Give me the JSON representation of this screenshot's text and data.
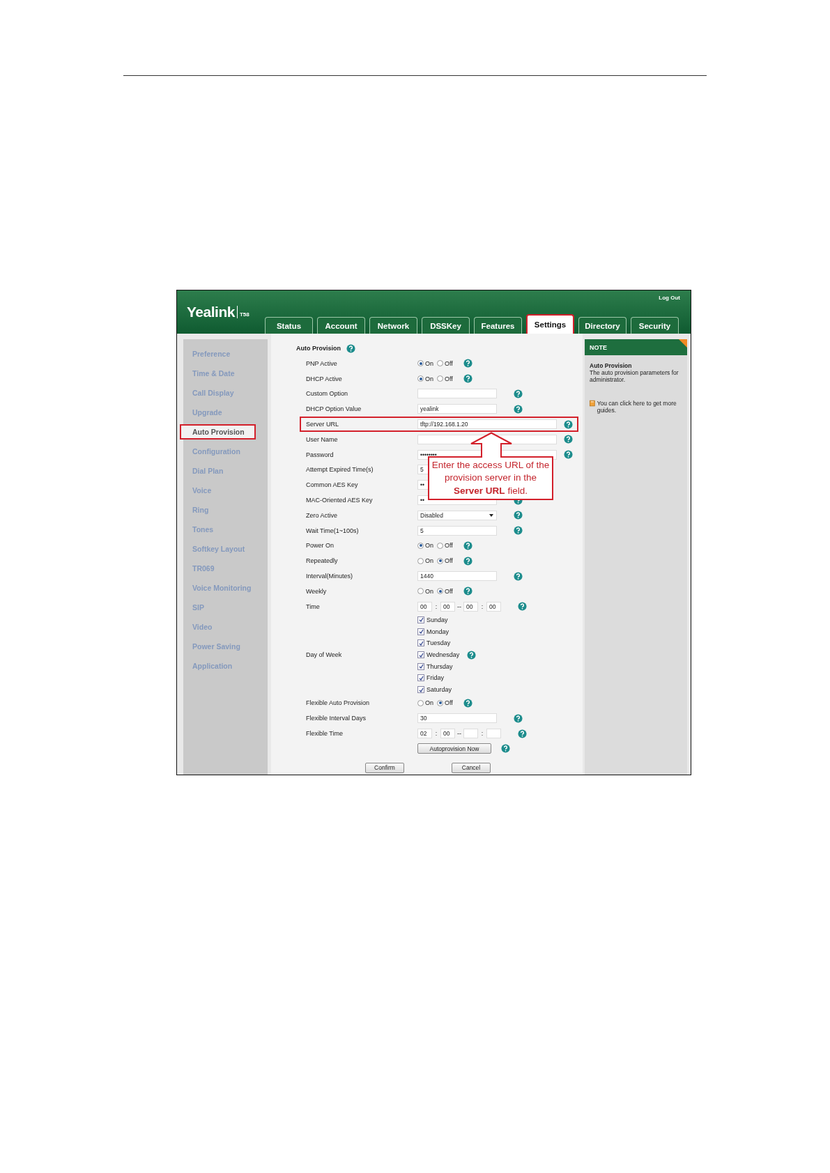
{
  "header": {
    "logo": "Yealink",
    "model": "T58",
    "logout": "Log Out"
  },
  "tabs": [
    {
      "label": "Status",
      "selected": false,
      "annotated": false
    },
    {
      "label": "Account",
      "selected": false,
      "annotated": false
    },
    {
      "label": "Network",
      "selected": false,
      "annotated": false
    },
    {
      "label": "DSSKey",
      "selected": false,
      "annotated": false
    },
    {
      "label": "Features",
      "selected": false,
      "annotated": false
    },
    {
      "label": "Settings",
      "selected": true,
      "annotated": true
    },
    {
      "label": "Directory",
      "selected": false,
      "annotated": false
    },
    {
      "label": "Security",
      "selected": false,
      "annotated": false
    }
  ],
  "sidebar": {
    "items": [
      {
        "label": "Preference",
        "selected": false,
        "annotated": false
      },
      {
        "label": "Time & Date",
        "selected": false,
        "annotated": false
      },
      {
        "label": "Call Display",
        "selected": false,
        "annotated": false
      },
      {
        "label": "Upgrade",
        "selected": false,
        "annotated": false
      },
      {
        "label": "Auto Provision",
        "selected": true,
        "annotated": true
      },
      {
        "label": "Configuration",
        "selected": false,
        "annotated": false
      },
      {
        "label": "Dial Plan",
        "selected": false,
        "annotated": false
      },
      {
        "label": "Voice",
        "selected": false,
        "annotated": false
      },
      {
        "label": "Ring",
        "selected": false,
        "annotated": false
      },
      {
        "label": "Tones",
        "selected": false,
        "annotated": false
      },
      {
        "label": "Softkey Layout",
        "selected": false,
        "annotated": false
      },
      {
        "label": "TR069",
        "selected": false,
        "annotated": false
      },
      {
        "label": "Voice Monitoring",
        "selected": false,
        "annotated": false
      },
      {
        "label": "SIP",
        "selected": false,
        "annotated": false
      },
      {
        "label": "Video",
        "selected": false,
        "annotated": false
      },
      {
        "label": "Power Saving",
        "selected": false,
        "annotated": false
      },
      {
        "label": "Application",
        "selected": false,
        "annotated": false
      }
    ]
  },
  "form": {
    "title": "Auto Provision",
    "rows": [
      {
        "kind": "radio",
        "label": "PNP Active",
        "options": [
          {
            "label": "On",
            "selected": true
          },
          {
            "label": "Off",
            "selected": false
          }
        ],
        "help": true,
        "annotated": false
      },
      {
        "kind": "radio",
        "label": "DHCP Active",
        "options": [
          {
            "label": "On",
            "selected": true
          },
          {
            "label": "Off",
            "selected": false
          }
        ],
        "help": true,
        "annotated": false
      },
      {
        "kind": "text",
        "label": "Custom Option",
        "wide": false,
        "help": true,
        "annotated": false
      },
      {
        "kind": "text",
        "label": "DHCP Option Value",
        "value": "yealink",
        "wide": false,
        "help": true,
        "annotated": false
      },
      {
        "kind": "text",
        "label": "Server URL",
        "value": "tftp://192.168.1.20",
        "wide": true,
        "help": true,
        "annotated": true
      },
      {
        "kind": "text",
        "label": "User Name",
        "wide": true,
        "help": true,
        "annotated": false
      },
      {
        "kind": "text",
        "label": "Password",
        "value": "••••••••",
        "wide": true,
        "help": true,
        "annotated": false
      },
      {
        "kind": "text",
        "label": "Attempt Expired Time(s)",
        "value": "5",
        "wide": false,
        "help": false,
        "annotated": false
      },
      {
        "kind": "text",
        "label": "Common AES Key",
        "value": "••",
        "wide": false,
        "help": false,
        "annotated": false
      },
      {
        "kind": "text",
        "label": "MAC-Oriented AES Key",
        "value": "••",
        "wide": false,
        "help": true,
        "annotated": false
      },
      {
        "kind": "select",
        "label": "Zero Active",
        "value": "Disabled",
        "help": true,
        "annotated": false
      },
      {
        "kind": "text",
        "label": "Wait Time(1~100s)",
        "value": "5",
        "wide": false,
        "help": true,
        "annotated": false
      },
      {
        "kind": "radio",
        "label": "Power On",
        "options": [
          {
            "label": "On",
            "selected": true
          },
          {
            "label": "Off",
            "selected": false
          }
        ],
        "help": true,
        "annotated": false
      },
      {
        "kind": "radio",
        "label": "Repeatedly",
        "options": [
          {
            "label": "On",
            "selected": false
          },
          {
            "label": "Off",
            "selected": true
          }
        ],
        "help": true,
        "annotated": false
      },
      {
        "kind": "text",
        "label": "Interval(Minutes)",
        "value": "1440",
        "wide": false,
        "help": true,
        "annotated": false
      },
      {
        "kind": "radio",
        "label": "Weekly",
        "options": [
          {
            "label": "On",
            "selected": false
          },
          {
            "label": "Off",
            "selected": true
          }
        ],
        "help": true,
        "annotated": false
      },
      {
        "kind": "time",
        "label": "Time",
        "parts": [
          {
            "kind": "box",
            "value": "00"
          },
          {
            "kind": "box",
            "value": "00"
          },
          {
            "kind": "box",
            "value": "00"
          },
          {
            "kind": "box",
            "value": "00"
          }
        ],
        "separators": [
          ":",
          "--",
          ":"
        ],
        "help": true,
        "annotated": false
      },
      {
        "kind": "checklist",
        "label": "Day of Week",
        "items": [
          {
            "label": "Sunday",
            "checked": true,
            "help": false
          },
          {
            "label": "Monday",
            "checked": true,
            "help": false
          },
          {
            "label": "Tuesday",
            "checked": true,
            "help": false
          },
          {
            "label": "Wednesday",
            "checked": true,
            "help": true
          },
          {
            "label": "Thursday",
            "checked": true,
            "help": false
          },
          {
            "label": "Friday",
            "checked": true,
            "help": false
          },
          {
            "label": "Saturday",
            "checked": true,
            "help": false
          }
        ],
        "annotated": false
      },
      {
        "kind": "radio",
        "label": "Flexible Auto Provision",
        "options": [
          {
            "label": "On",
            "selected": false
          },
          {
            "label": "Off",
            "selected": true
          }
        ],
        "help": true,
        "annotated": false
      },
      {
        "kind": "text",
        "label": "Flexible Interval Days",
        "value": "30",
        "wide": false,
        "help": true,
        "annotated": false
      },
      {
        "kind": "time",
        "label": "Flexible Time",
        "parts": [
          {
            "kind": "box",
            "value": "02"
          },
          {
            "kind": "box",
            "value": "00"
          },
          {
            "kind": "box"
          },
          {
            "kind": "box"
          }
        ],
        "separators": [
          ":",
          "--",
          ":"
        ],
        "help": true,
        "annotated": false
      },
      {
        "kind": "action",
        "button": "Autoprovision Now",
        "help": true,
        "annotated": false
      }
    ],
    "buttons": [
      "Confirm",
      "Cancel"
    ]
  },
  "note": {
    "header": "NOTE",
    "title": "Auto Provision",
    "text": "The auto provision parameters for administrator.",
    "link": "You can click here to get more guides."
  },
  "callout": {
    "text": "Enter the access URL of the provision server in the **Server URL** field."
  }
}
